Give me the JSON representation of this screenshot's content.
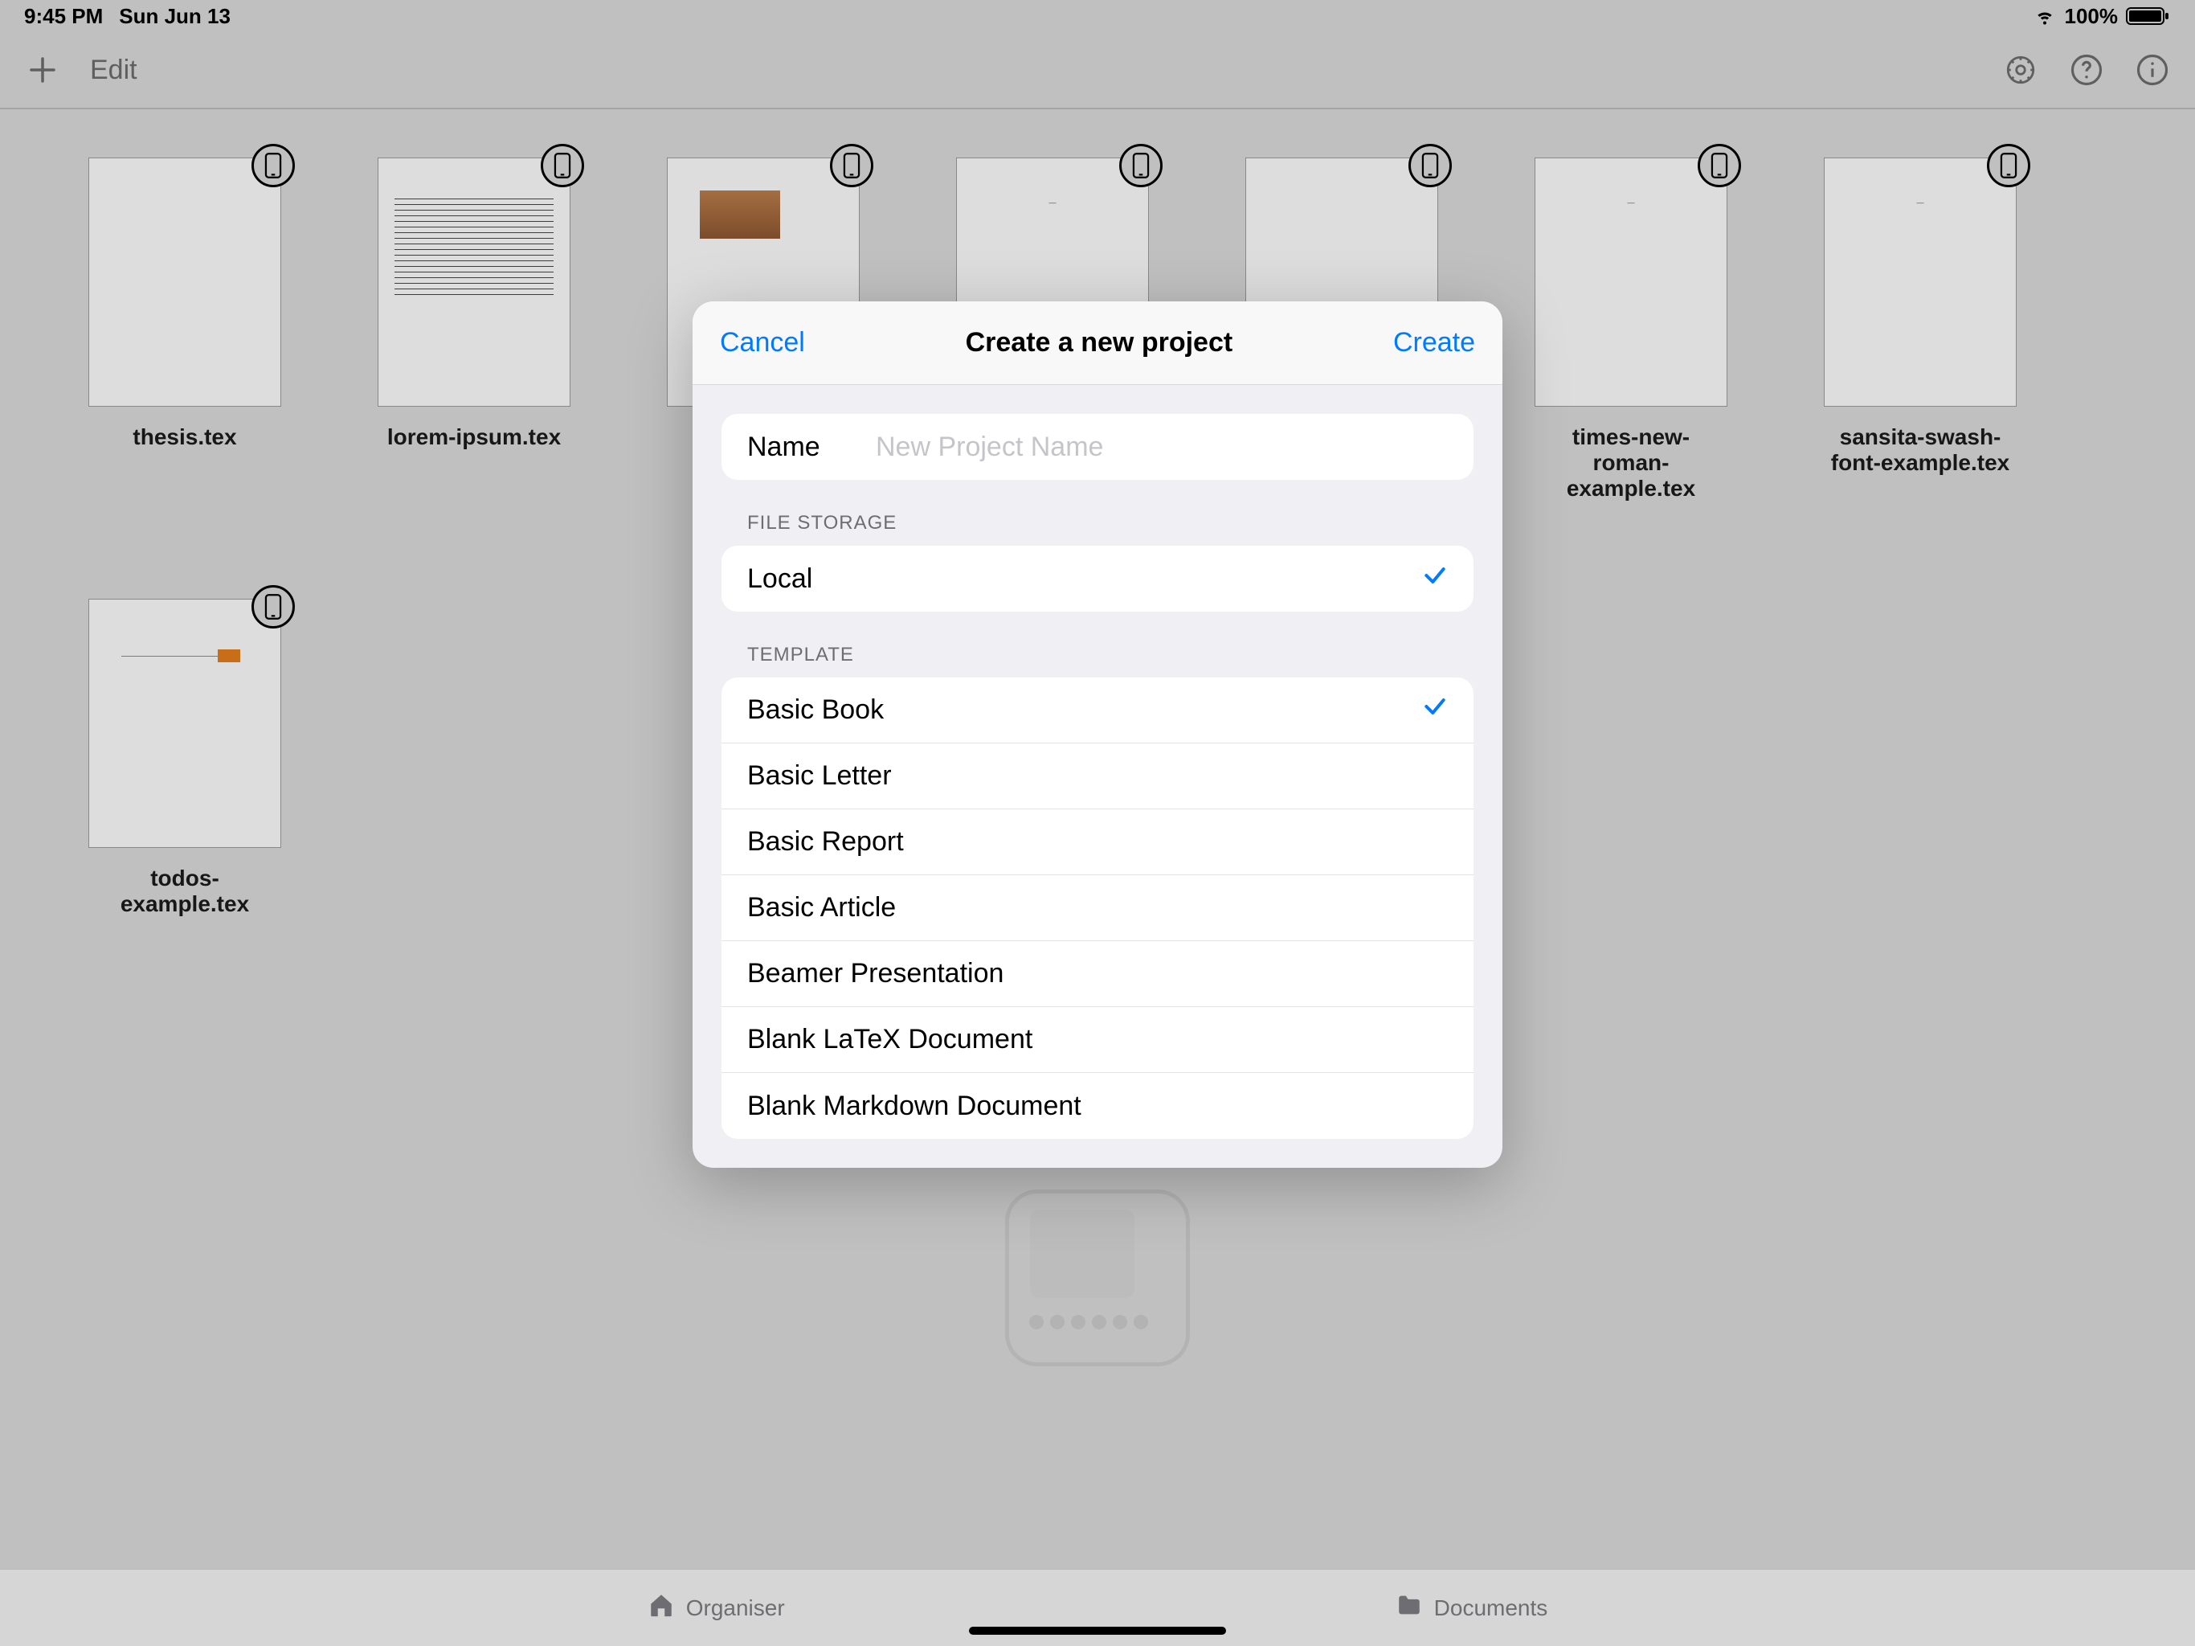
{
  "status": {
    "time": "9:45 PM",
    "date": "Sun Jun 13",
    "battery_pct": "100%"
  },
  "toolbar": {
    "edit_label": "Edit"
  },
  "documents": [
    {
      "name": "thesis.tex"
    },
    {
      "name": "lorem-ipsum.tex"
    },
    {
      "name": ""
    },
    {
      "name": ""
    },
    {
      "name": ""
    },
    {
      "name": "times-new-roman-example.tex"
    },
    {
      "name": "sansita-swash-font-example.tex"
    },
    {
      "name": "todos-example.tex"
    }
  ],
  "modal": {
    "cancel": "Cancel",
    "title": "Create a new project",
    "create": "Create",
    "name_label": "Name",
    "name_placeholder": "New Project Name",
    "name_value": "",
    "file_storage_header": "FILE STORAGE",
    "storage": [
      {
        "label": "Local",
        "selected": true
      }
    ],
    "template_header": "TEMPLATE",
    "templates": [
      {
        "label": "Basic Book",
        "selected": true
      },
      {
        "label": "Basic Letter",
        "selected": false
      },
      {
        "label": "Basic Report",
        "selected": false
      },
      {
        "label": "Basic Article",
        "selected": false
      },
      {
        "label": "Beamer Presentation",
        "selected": false
      },
      {
        "label": "Blank LaTeX Document",
        "selected": false
      },
      {
        "label": "Blank Markdown Document",
        "selected": false
      }
    ]
  },
  "tabs": {
    "organiser": "Organiser",
    "documents": "Documents"
  },
  "colors": {
    "accent": "#007aff"
  }
}
